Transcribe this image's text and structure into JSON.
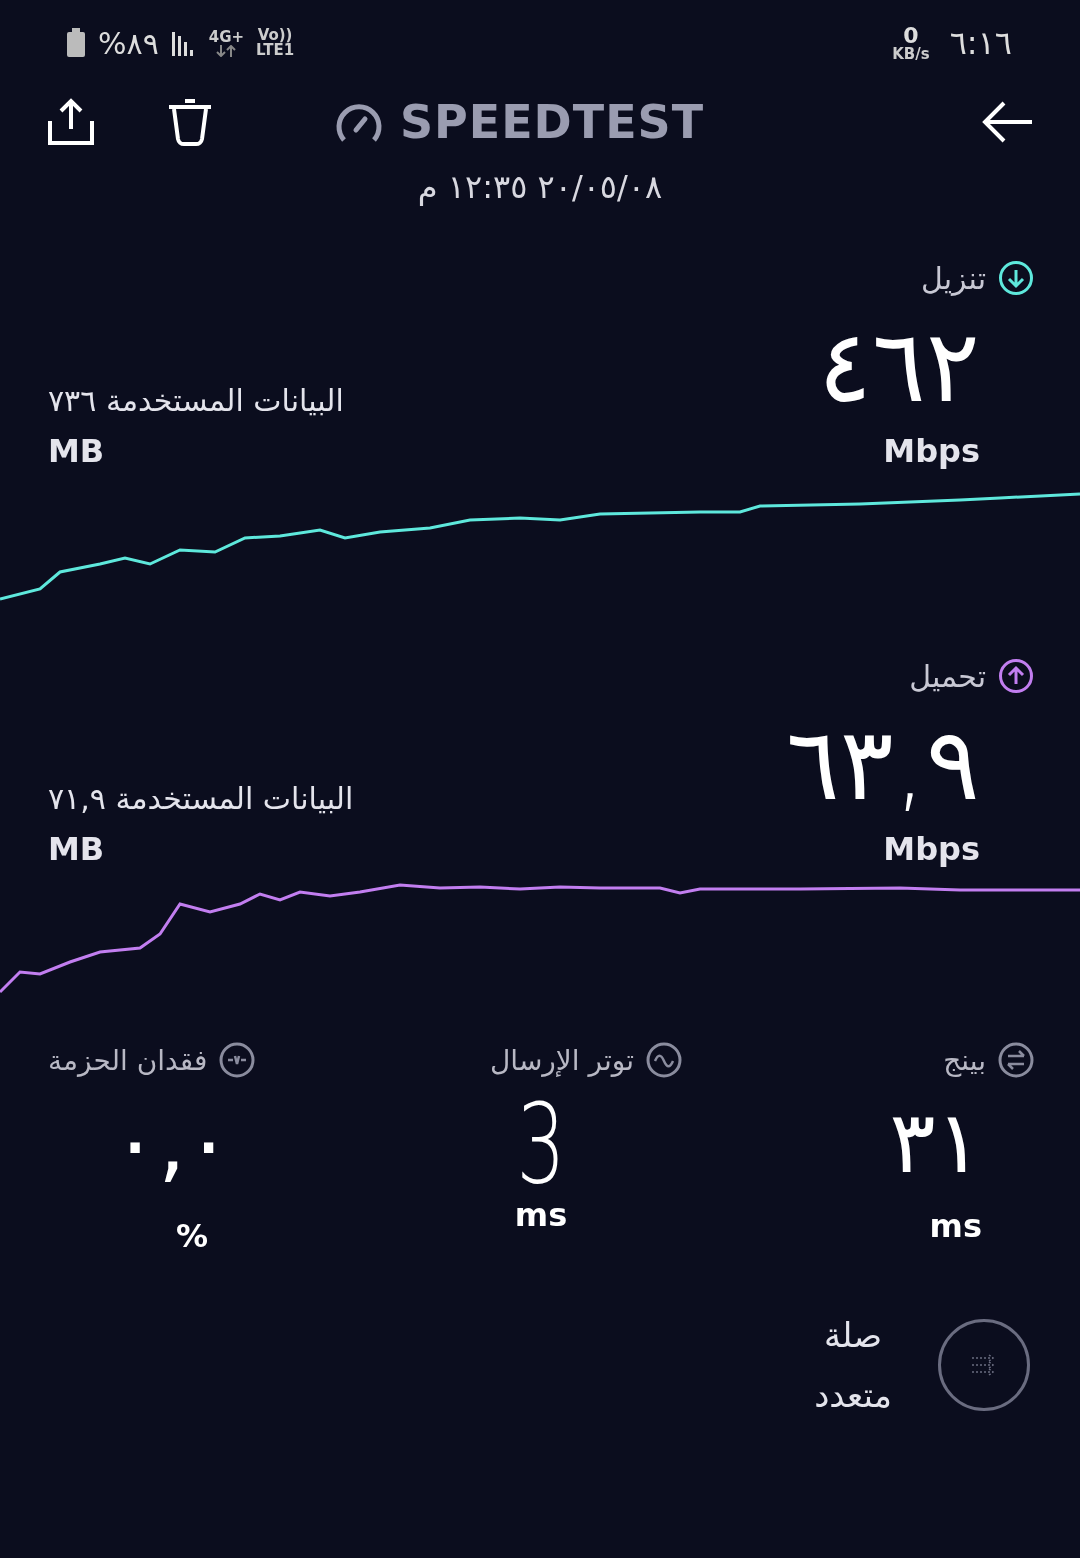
{
  "status_bar": {
    "battery": "%٨٩",
    "network": "4G+",
    "volte": "Vo))",
    "lte": "LTE1",
    "speed_value": "0",
    "speed_unit": "KB/s",
    "time": "٦:١٦"
  },
  "header": {
    "title": "SPEEDTEST",
    "date": "٢٠/٠٥/٠٨ ١٢:٣٥ م"
  },
  "results": [
    {
      "kind": "download",
      "label": "تنزيل",
      "value": "٤٦٢",
      "unit": "Mbps",
      "data_used": "البيانات المستخدمة ٧٣٦",
      "data_unit": "MB",
      "color": "#5ee8dc"
    },
    {
      "kind": "upload",
      "label": "تحميل",
      "value": "٦٣,٩",
      "unit": "Mbps",
      "data_used": "البيانات المستخدمة ٧١,٩",
      "data_unit": "MB",
      "color": "#c27ef0"
    }
  ],
  "metrics": [
    {
      "kind": "ping",
      "label": "بينج",
      "value": "٣١",
      "unit": "ms"
    },
    {
      "kind": "jitter",
      "label": "توتر الإرسال",
      "value": "3",
      "unit": "ms"
    },
    {
      "kind": "loss",
      "label": "فقدان الحزمة",
      "value": "٠,٠",
      "unit": "%"
    }
  ],
  "connection": {
    "line_1": "صلة",
    "line_2": "متعدد"
  }
}
